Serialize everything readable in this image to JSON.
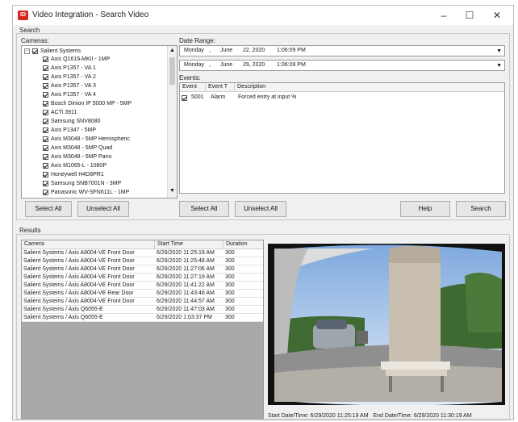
{
  "window": {
    "title": "Video Integration - Search Video",
    "icon_text": "ID",
    "controls": {
      "minimize": "–",
      "maximize": "☐",
      "close": "✕"
    }
  },
  "search": {
    "group_label": "Search",
    "cameras_label": "Cameras:",
    "root": "Salient Systems",
    "cameras": [
      "Axis Q1615̶ MKII - 1MP",
      "Axis P1357 - VA 1",
      "Axis P1357 - VA 2",
      "Axis P1357 - VA 3",
      "Axis P1357 - VA 4",
      "Bosch Dinion IP 5000 MP - 5MP",
      "ACTi 3911",
      "Samsung SNV8080",
      "Axis P1347 - 5MP",
      "Axis M3048 - 5MP Hemispheric",
      "Axis M3048 - 5MP Quad",
      "Axis M3048 - 5MP Pano",
      "Axis M1065-L - 1080P",
      "Honeywell H4D8PR1",
      "Samsung SNB7001N - 3MP",
      "Panasonic WV-SFN611L - 1MP"
    ],
    "date_range_label": "Date Range:",
    "date_from": {
      "day": "Monday",
      "month": "June",
      "date": "22, 2020",
      "time": "1:06:09 PM"
    },
    "date_to": {
      "day": "Monday",
      "month": "June",
      "date": "29, 2020",
      "time": "1:06:09 PM"
    },
    "events_label": "Events:",
    "events_columns": [
      "Event",
      "Event T",
      "Description"
    ],
    "events": [
      {
        "id": "5001",
        "type": "Alarm",
        "description": "Forced entry at input %"
      }
    ],
    "buttons": {
      "select_all_cameras": "Select All",
      "unselect_all_cameras": "Unselect All",
      "select_all_events": "Select All",
      "unselect_all_events": "Unselect All",
      "help": "Help",
      "search": "Search"
    }
  },
  "results": {
    "group_label": "Results",
    "columns": [
      "Camera",
      "Start Time",
      "Duration"
    ],
    "rows": [
      {
        "camera": "Salient Systems / Axis A8004-VE Front Door",
        "start": "6/29/2020 11:25:19 AM",
        "duration": "300"
      },
      {
        "camera": "Salient Systems / Axis A8004-VE Front Door",
        "start": "6/29/2020 11:25:48 AM",
        "duration": "300"
      },
      {
        "camera": "Salient Systems / Axis A8004-VE Front Door",
        "start": "6/29/2020 11:27:06 AM",
        "duration": "300"
      },
      {
        "camera": "Salient Systems / Axis A8004-VE Front Door",
        "start": "6/29/2020 11:27:19 AM",
        "duration": "300"
      },
      {
        "camera": "Salient Systems / Axis A8004-VE Front Door",
        "start": "6/29/2020 11:41:22 AM",
        "duration": "300"
      },
      {
        "camera": "Salient Systems / Axis A8004-VE Rear Door",
        "start": "6/29/2020 11:43:46 AM",
        "duration": "300"
      },
      {
        "camera": "Salient Systems / Axis A8004-VE Front Door",
        "start": "6/29/2020 11:44:57 AM",
        "duration": "300"
      },
      {
        "camera": "Salient Systems / Axis Q6055-E",
        "start": "6/29/2020 11:47:03 AM",
        "duration": "300"
      },
      {
        "camera": "Salient Systems / Axis Q6055-E",
        "start": "6/29/2020 1:03:37 PM",
        "duration": "300"
      }
    ],
    "playback": {
      "start_label": "Start Date/Time:",
      "start_value": "6/29/2020 11:25:19 AM",
      "end_label": "End Date/Time:",
      "end_value": "6/29/2020 11:30:19 AM"
    }
  },
  "colors": {
    "title_icon": "#d8261d",
    "window_bg": "#f0f0f0",
    "list_bg": "#ffffff",
    "results_empty": "#a9a9a9"
  }
}
